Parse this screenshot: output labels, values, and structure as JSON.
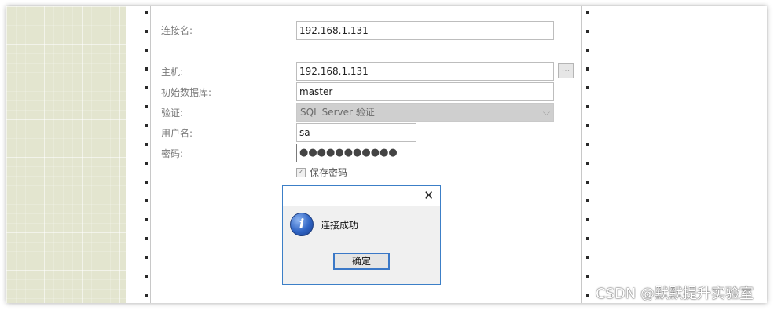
{
  "connection_form": {
    "connection_name_label": "连接名:",
    "connection_name_value": "192.168.1.131",
    "host_label": "主机:",
    "host_value": "192.168.1.131",
    "browse_label": "...",
    "initial_db_label": "初始数据库:",
    "initial_db_value": "master",
    "auth_label": "验证:",
    "auth_value": "SQL Server 验证",
    "username_label": "用户名:",
    "username_value": "sa",
    "password_label": "密码:",
    "password_value": "●●●●●●●●●●●",
    "save_password_label": "保存密码",
    "save_password_checked": true
  },
  "dialog": {
    "close_symbol": "✕",
    "icon_glyph": "i",
    "message": "连接成功",
    "ok_label": "确定"
  },
  "icons": {
    "checkmark": "✓",
    "dropdown": "⌵"
  },
  "watermark": "CSDN @默默提升实验室",
  "colors": {
    "grid_background": "#e3e5cf",
    "dialog_border": "#3c7fc7",
    "ok_button_border": "#3b78c7",
    "disabled_select": "#cfcfcf"
  }
}
